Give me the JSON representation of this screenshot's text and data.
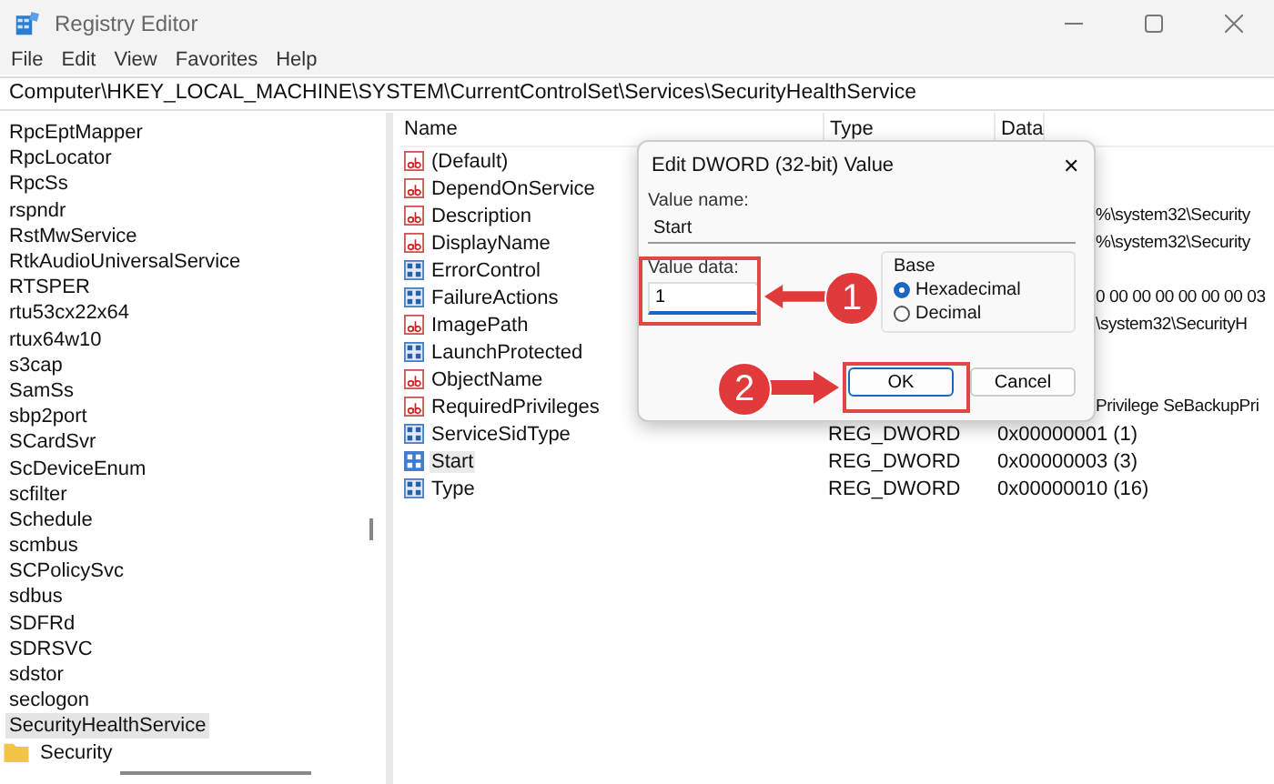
{
  "window": {
    "title": "Registry Editor"
  },
  "menu": [
    "File",
    "Edit",
    "View",
    "Favorites",
    "Help"
  ],
  "address": "Computer\\HKEY_LOCAL_MACHINE\\SYSTEM\\CurrentControlSet\\Services\\SecurityHealthService",
  "tree": [
    {
      "label": "RpcEptMapper",
      "selected": false
    },
    {
      "label": "RpcLocator",
      "selected": false
    },
    {
      "label": "RpcSs",
      "selected": false
    },
    {
      "label": "rspndr",
      "selected": false
    },
    {
      "label": "RstMwService",
      "selected": false
    },
    {
      "label": "RtkAudioUniversalService",
      "selected": false
    },
    {
      "label": "RTSPER",
      "selected": false
    },
    {
      "label": "rtu53cx22x64",
      "selected": false
    },
    {
      "label": "rtux64w10",
      "selected": false
    },
    {
      "label": "s3cap",
      "selected": false
    },
    {
      "label": "SamSs",
      "selected": false
    },
    {
      "label": "sbp2port",
      "selected": false
    },
    {
      "label": "SCardSvr",
      "selected": false
    },
    {
      "label": "ScDeviceEnum",
      "selected": false
    },
    {
      "label": "scfilter",
      "selected": false
    },
    {
      "label": "Schedule",
      "selected": false
    },
    {
      "label": "scmbus",
      "selected": false
    },
    {
      "label": "SCPolicySvc",
      "selected": false
    },
    {
      "label": "sdbus",
      "selected": false
    },
    {
      "label": "SDFRd",
      "selected": false
    },
    {
      "label": "SDRSVC",
      "selected": false
    },
    {
      "label": "sdstor",
      "selected": false
    },
    {
      "label": "seclogon",
      "selected": false
    },
    {
      "label": "SecurityHealthService",
      "selected": true,
      "children": [
        {
          "label": "Security",
          "selected": false
        }
      ]
    }
  ],
  "columns": [
    "Name",
    "Type",
    "Data"
  ],
  "values": [
    {
      "name": "(Default)",
      "kind": "string",
      "selected": false
    },
    {
      "name": "DependOnService",
      "kind": "string",
      "selected": false
    },
    {
      "name": "Description",
      "kind": "string",
      "data": "%\\system32\\Security",
      "selected": false
    },
    {
      "name": "DisplayName",
      "kind": "string",
      "data": "%\\system32\\Security",
      "selected": false
    },
    {
      "name": "ErrorControl",
      "kind": "binary",
      "selected": false
    },
    {
      "name": "FailureActions",
      "kind": "binary",
      "data": "0 00 00 00 00 00 00 03",
      "selected": false
    },
    {
      "name": "ImagePath",
      "kind": "string",
      "data": "\\system32\\SecurityH",
      "selected": false
    },
    {
      "name": "LaunchProtected",
      "kind": "binary",
      "selected": false
    },
    {
      "name": "ObjectName",
      "kind": "string",
      "selected": false
    },
    {
      "name": "RequiredPrivileges",
      "kind": "string",
      "data": "Privilege SeBackupPri",
      "selected": false
    },
    {
      "name": "ServiceSidType",
      "kind": "binary",
      "type": "REG_DWORD",
      "data": "0x00000001 (1)",
      "selected": false
    },
    {
      "name": "Start",
      "kind": "binary",
      "type": "REG_DWORD",
      "data": "0x00000003 (3)",
      "selected": true
    },
    {
      "name": "Type",
      "kind": "binary",
      "type": "REG_DWORD",
      "data": "0x00000010 (16)",
      "selected": false
    }
  ],
  "dialog": {
    "title": "Edit DWORD (32-bit) Value",
    "close": "✕",
    "value_name_label": "Value name:",
    "value_name": "Start",
    "value_data_label": "Value data:",
    "value_data": "1",
    "base_label": "Base",
    "base_options": [
      {
        "label": "Hexadecimal",
        "selected": true
      },
      {
        "label": "Decimal",
        "selected": false
      }
    ],
    "buttons": [
      "OK",
      "Cancel"
    ]
  },
  "annotations": [
    {
      "label": "1"
    },
    {
      "label": "2"
    }
  ]
}
